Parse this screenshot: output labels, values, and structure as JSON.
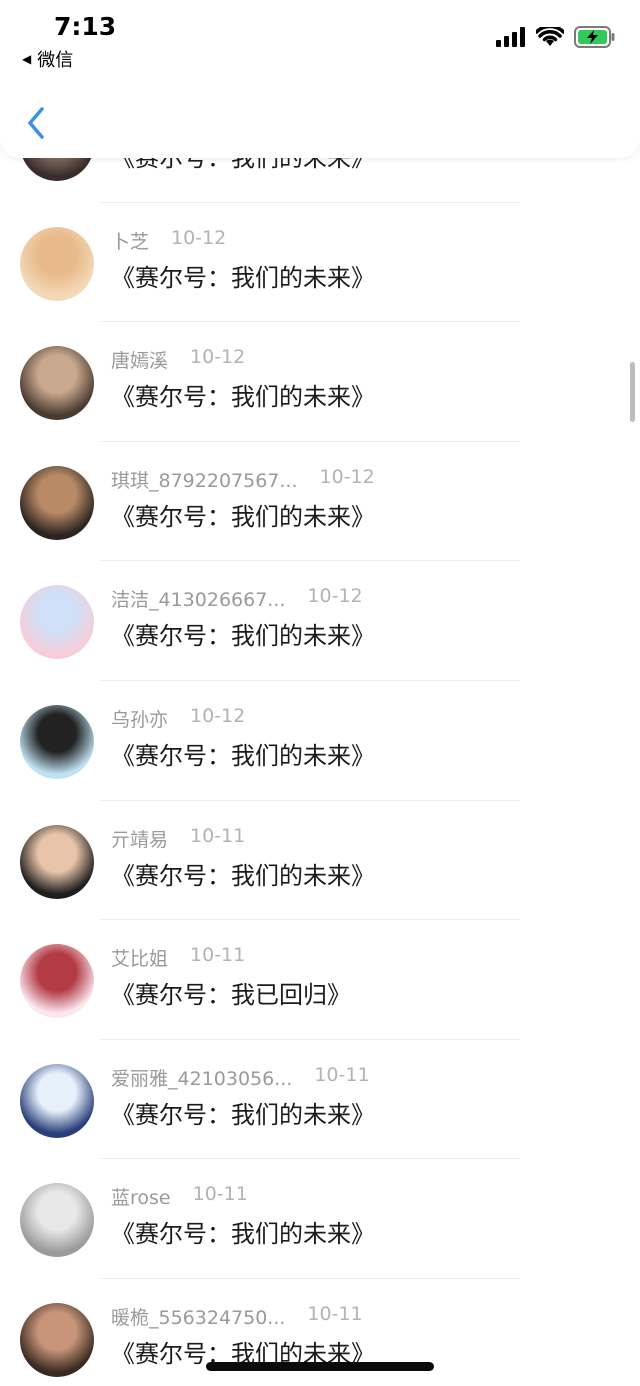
{
  "status_bar": {
    "time": "7:13",
    "back_app_label": "微信",
    "icons": [
      "signal-icon",
      "wifi-icon",
      "battery-charging-icon"
    ]
  },
  "nav": {
    "back_icon": "chevron-left-icon",
    "accent": "#3d8fe0"
  },
  "comments": [
    {
      "name": "",
      "date": "",
      "message": "《赛尔号：我们的未来》",
      "avatar_colors": [
        "#3a2c2c",
        "#8f7a6a"
      ]
    },
    {
      "name": "卜芝",
      "date": "10-12",
      "message": "《赛尔号：我们的未来》",
      "avatar_colors": [
        "#f4d9b8",
        "#e8b98a"
      ]
    },
    {
      "name": "唐嫣溪",
      "date": "10-12",
      "message": "《赛尔号：我们的未来》",
      "avatar_colors": [
        "#4a3a30",
        "#c9a98f"
      ]
    },
    {
      "name": "琪琪_8792207567...",
      "date": "10-12",
      "message": "《赛尔号：我们的未来》",
      "avatar_colors": [
        "#2b2420",
        "#b98a66"
      ]
    },
    {
      "name": "洁洁_413026667...",
      "date": "10-12",
      "message": "《赛尔号：我们的未来》",
      "avatar_colors": [
        "#f7cdd8",
        "#cfe0f7"
      ]
    },
    {
      "name": "乌孙亦",
      "date": "10-12",
      "message": "《赛尔号：我们的未来》",
      "avatar_colors": [
        "#bfe1f2",
        "#222222"
      ]
    },
    {
      "name": "亓靖易",
      "date": "10-11",
      "message": "《赛尔号：我们的未来》",
      "avatar_colors": [
        "#1e1e1e",
        "#e8c4aa"
      ]
    },
    {
      "name": "艾比姐",
      "date": "10-11",
      "message": "《赛尔号：我已回归》",
      "avatar_colors": [
        "#fbe7ee",
        "#b23b45"
      ]
    },
    {
      "name": "爱丽雅_42103056...",
      "date": "10-11",
      "message": "《赛尔号：我们的未来》",
      "avatar_colors": [
        "#2a3f7a",
        "#e7f1fb"
      ]
    },
    {
      "name": "蓝rose",
      "date": "10-11",
      "message": "《赛尔号：我们的未来》",
      "avatar_colors": [
        "#9b9b9b",
        "#e8e8e8"
      ]
    },
    {
      "name": "暖桅_556324750...",
      "date": "10-11",
      "message": "《赛尔号：我们的未来》",
      "avatar_colors": [
        "#3a2a22",
        "#c8957a"
      ]
    }
  ]
}
